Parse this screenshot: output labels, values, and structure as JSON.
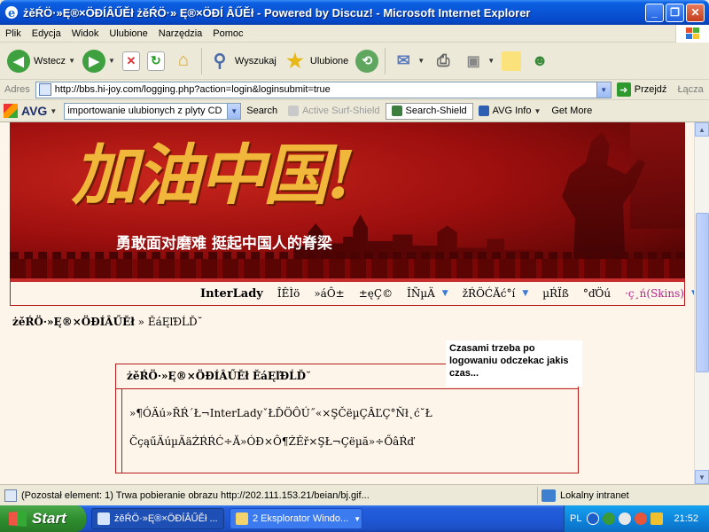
{
  "window": {
    "title": "żěŔÖ·»Ę®×ÖĐÍÂŰĚł żěŔÖ·» Ę®×ÖĐÍ ÂŰĚł - Powered by Discuz! - Microsoft Internet Explorer",
    "min": "_",
    "max": "❐",
    "close": "✕"
  },
  "menu": [
    "Plik",
    "Edycja",
    "Widok",
    "Ulubione",
    "Narzędzia",
    "Pomoc"
  ],
  "toolbar": {
    "back": "Wstecz",
    "search": "Wyszukaj",
    "favorites": "Ulubione"
  },
  "address": {
    "label": "Adres",
    "url": "http://bbs.hi-joy.com/logging.php?action=login&loginsubmit=true",
    "go": "Przejdź",
    "links": "Łącza"
  },
  "avg": {
    "logo": "AVG",
    "search_value": "importowanie ulubionych z plyty CD",
    "search_btn": "Search",
    "active_surf": "Active  Surf-Shield",
    "search_shield": "Search-Shield",
    "avg_info": "AVG Info",
    "get_more": "Get More"
  },
  "banner": {
    "title": "加油中国!",
    "slogan": "勇敢面对磨难 挺起中国人的脊梁"
  },
  "nav": {
    "brand": "InterLady",
    "items": [
      "ÎÊÌö",
      "»áÔ±",
      "±ęÇ©",
      "ÎÑµÄ",
      "žŔÖĆĂć°í",
      "µŔÏß",
      "°ďÖú"
    ],
    "skins": "·ç¸ń(Skins)"
  },
  "breadcrumb": {
    "strong": "żěŔÖ·»Ę®×ÖĐÍÂŰĚł",
    "rest": " » ĚáĘľĐĹĎ˘"
  },
  "tooltip": "Czasami trzeba po logowaniu odczekac jakis czas...",
  "login_box": {
    "header": "żěŔÖ·»Ę®×ÖĐÍÂŰĚł ĚáĘľĐĹĎ˘",
    "line1": "»¶ÓÄú»ŘŔ´Ł¬InterLadyˇŁĎÖÔÚ˝«×ŞČëµÇÂĽÇ°Ňł˛ć˘Ł",
    "line2": "ČçąűÄúµÄäŻŔŔĆ÷Ă»ÓĐ×Ô¶ŻĚř×ŞŁ¬Çëµă»÷ŐâŔď"
  },
  "status": {
    "message": "(Pozostał element: 1) Trwa pobieranie obrazu http://202.111.153.21/beian/bj.gif...",
    "zone": "Lokalny intranet"
  },
  "taskbar": {
    "start": "Start",
    "task1": "żěŔÖ·»Ę®×ÖĐÍÂŰĚł ...",
    "task2": "2 Eksplorator Windo...",
    "lang": "PL",
    "clock": "21:52"
  },
  "colors": {
    "accent_border": "#b91c1c",
    "content_bg": "#fdf5ea",
    "skins_link": "#b0278a"
  }
}
